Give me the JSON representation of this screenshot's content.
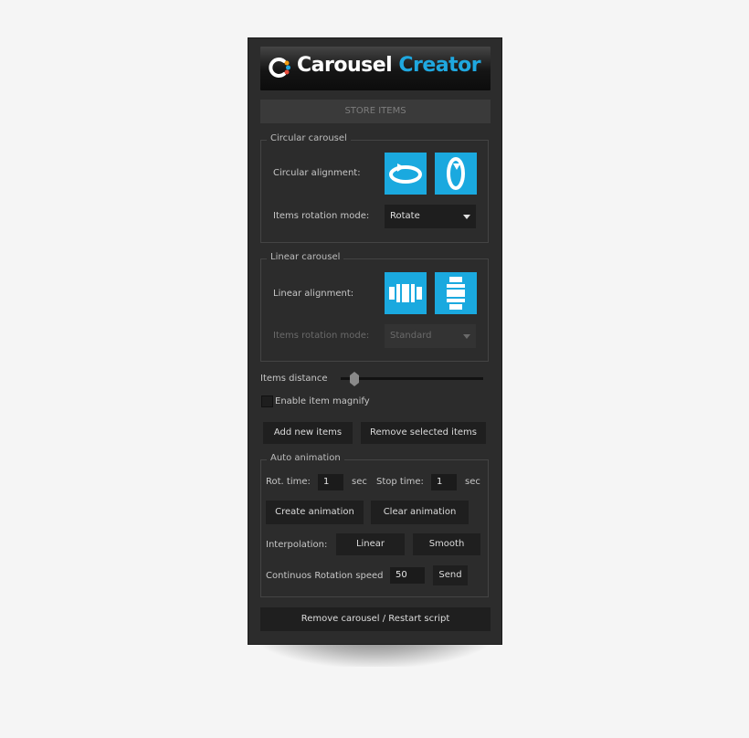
{
  "logo": {
    "word1": "Carousel",
    "word2": "Creator",
    "accent": "#1fa8e0"
  },
  "store_items": "STORE ITEMS",
  "circular": {
    "title": "Circular carousel",
    "alignment_label": "Circular alignment:",
    "rotation_label": "Items rotation mode:",
    "rotation_value": "Rotate",
    "icons": [
      "horizontal-rotation-icon",
      "vertical-rotation-icon"
    ]
  },
  "linear": {
    "title": "Linear carousel",
    "alignment_label": "Linear alignment:",
    "rotation_label": "Items rotation mode:",
    "rotation_value": "Standard",
    "icons": [
      "horizontal-linear-icon",
      "vertical-linear-icon"
    ]
  },
  "items_distance_label": "Items distance",
  "items_distance_value": 0.1,
  "enable_magnify_label": "Enable item magnify",
  "enable_magnify_checked": false,
  "add_items_label": "Add new items",
  "remove_items_label": "Remove selected items",
  "auto": {
    "title": "Auto animation",
    "rot_time_label": "Rot. time:",
    "rot_time_value": "1",
    "sec1": "sec",
    "stop_time_label": "Stop time:",
    "stop_time_value": "1",
    "sec2": "sec",
    "create_label": "Create animation",
    "clear_label": "Clear animation",
    "interp_label": "Interpolation:",
    "linear_label": "Linear",
    "smooth_label": "Smooth",
    "speed_label": "Continuos Rotation speed",
    "speed_value": "50",
    "send_label": "Send"
  },
  "remove_carousel_label": "Remove carousel / Restart script"
}
